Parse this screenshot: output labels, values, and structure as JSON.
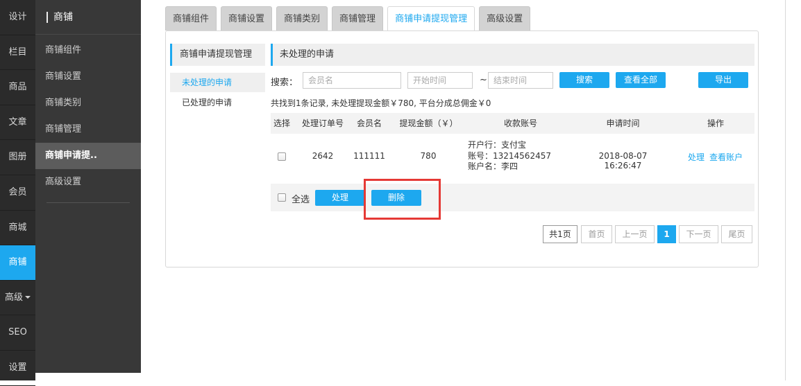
{
  "rail": [
    {
      "label": "设计",
      "active": false
    },
    {
      "label": "栏目",
      "active": false
    },
    {
      "label": "商品",
      "active": false
    },
    {
      "label": "文章",
      "active": false
    },
    {
      "label": "图册",
      "active": false
    },
    {
      "label": "会员",
      "active": false
    },
    {
      "label": "商城",
      "active": false
    },
    {
      "label": "商铺",
      "active": true
    },
    {
      "label": "高级",
      "active": false,
      "has_caret": true
    },
    {
      "label": "SEO",
      "active": false
    },
    {
      "label": "设置",
      "active": false
    }
  ],
  "sub_nav": {
    "title": "商铺",
    "items": [
      "商铺组件",
      "商铺设置",
      "商铺类别",
      "商铺管理",
      "商铺申请提..",
      "高级设置"
    ],
    "active_index": 4
  },
  "tabs": [
    "商铺组件",
    "商铺设置",
    "商铺类别",
    "商铺管理",
    "商铺申请提现管理",
    "高级设置"
  ],
  "active_tab": 4,
  "side_panel": {
    "title": "商铺申请提现管理",
    "links": [
      "未处理的申请",
      "已处理的申请"
    ]
  },
  "main": {
    "title": "未处理的申请",
    "search": {
      "label": "搜索：",
      "member_placeholder": "会员名",
      "start_placeholder": "开始时间",
      "tilde": "~",
      "end_placeholder": "结束时间",
      "search_btn": "搜索",
      "view_all_btn": "查看全部",
      "export_btn": "导出"
    },
    "summary": "共找到1条记录, 未处理提现金额￥780, 平台分成总佣金￥0",
    "columns": [
      "选择",
      "处理订单号",
      "会员名",
      "提现金额（￥）",
      "收款账号",
      "申请时间",
      "操作"
    ],
    "row": {
      "order_no": "2642",
      "member": "111111",
      "amount": "780",
      "account_lines": [
        "开户行：支付宝",
        "账号：13214562457",
        "账户名：李四"
      ],
      "time": "2018-08-07 16:26:47",
      "action_process": "处理",
      "action_view": "查看账户"
    },
    "batch": {
      "select_all": "全选",
      "process_btn": "处理",
      "delete_btn": "删除"
    },
    "pagination": {
      "total": "共1页",
      "first": "首页",
      "prev": "上一页",
      "current": "1",
      "next": "下一页",
      "last": "尾页"
    }
  },
  "colors": {
    "accent": "#1da8ef",
    "highlight": "#e53935",
    "rail_bg": "#2b2b2b",
    "sub_bg": "#383838"
  }
}
